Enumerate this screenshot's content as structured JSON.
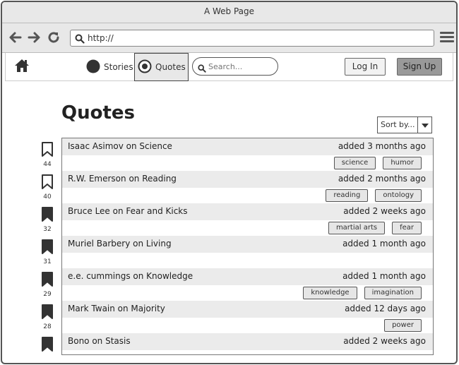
{
  "window": {
    "title": "A Web Page"
  },
  "browser": {
    "url": "http://"
  },
  "nav": {
    "stories_label": "Stories",
    "quotes_label": "Quotes",
    "search_placeholder": "Search...",
    "login_label": "Log In",
    "signup_label": "Sign Up"
  },
  "page": {
    "title": "Quotes",
    "sort_label": "Sort by..."
  },
  "quotes": [
    {
      "title": "Isaac Asimov on Science",
      "added": "added 3 months ago",
      "tags": [
        "science",
        "humor"
      ],
      "votes": "44",
      "bookmarked": false
    },
    {
      "title": "R.W. Emerson on Reading",
      "added": "added 2 months ago",
      "tags": [
        "reading",
        "ontology"
      ],
      "votes": "40",
      "bookmarked": false
    },
    {
      "title": "Bruce Lee on Fear and Kicks",
      "added": "added 2 weeks ago",
      "tags": [
        "martial arts",
        "fear"
      ],
      "votes": "32",
      "bookmarked": true
    },
    {
      "title": "Muriel Barbery on Living",
      "added": "added 1 month ago",
      "tags": [],
      "votes": "31",
      "bookmarked": true
    },
    {
      "title": "e.e. cummings on Knowledge",
      "added": "added 1 month ago",
      "tags": [
        "knowledge",
        "imagination"
      ],
      "votes": "29",
      "bookmarked": true
    },
    {
      "title": "Mark Twain on Majority",
      "added": "added 12 days ago",
      "tags": [
        "power"
      ],
      "votes": "28",
      "bookmarked": true
    },
    {
      "title": "Bono on Stasis",
      "added": "added 2 weeks ago",
      "tags": [],
      "votes": "",
      "bookmarked": true
    }
  ],
  "icons": {
    "back": "arrow-left-icon",
    "forward": "arrow-right-icon",
    "reload": "reload-icon",
    "menu": "hamburger-menu-icon",
    "home": "home-icon",
    "bookmark": "bookmark-icon"
  },
  "colors": {
    "chrome_bg": "#e8e8e8",
    "row_bg": "#ebebeb",
    "signup_bg": "#999999"
  }
}
